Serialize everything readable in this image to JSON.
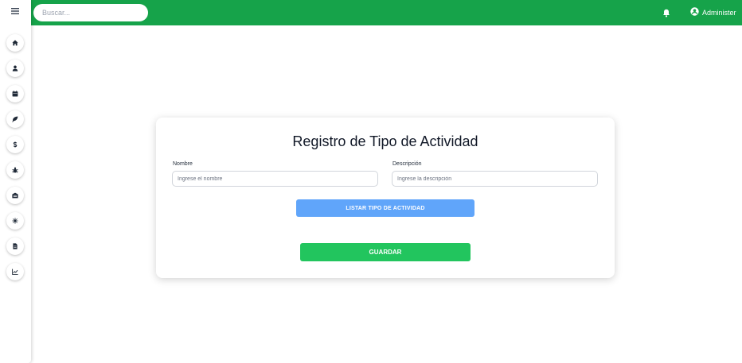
{
  "topbar": {
    "search_placeholder": "Buscar...",
    "user_name": "Administer",
    "color": "#16a34a"
  },
  "sidebar": {
    "menu_icon": "hamburger-icon",
    "items": [
      {
        "icon": "home-icon"
      },
      {
        "icon": "user-icon"
      },
      {
        "icon": "calendar-icon"
      },
      {
        "icon": "leaf-icon"
      },
      {
        "icon": "dollar-icon"
      },
      {
        "icon": "bug-icon"
      },
      {
        "icon": "warehouse-icon"
      },
      {
        "icon": "virus-icon"
      },
      {
        "icon": "document-icon"
      },
      {
        "icon": "chart-icon"
      }
    ]
  },
  "form": {
    "title": "Registro de Tipo de Actividad",
    "name_label": "Nombre",
    "name_placeholder": "Ingrese el nombre",
    "description_label": "Descripción",
    "description_placeholder": "Ingrese la descripción",
    "list_button": "LISTAR TIPO DE ACTIVIDAD",
    "save_button": "GUARDAR",
    "list_button_color": "#60a5fa",
    "save_button_color": "#22c55e"
  }
}
